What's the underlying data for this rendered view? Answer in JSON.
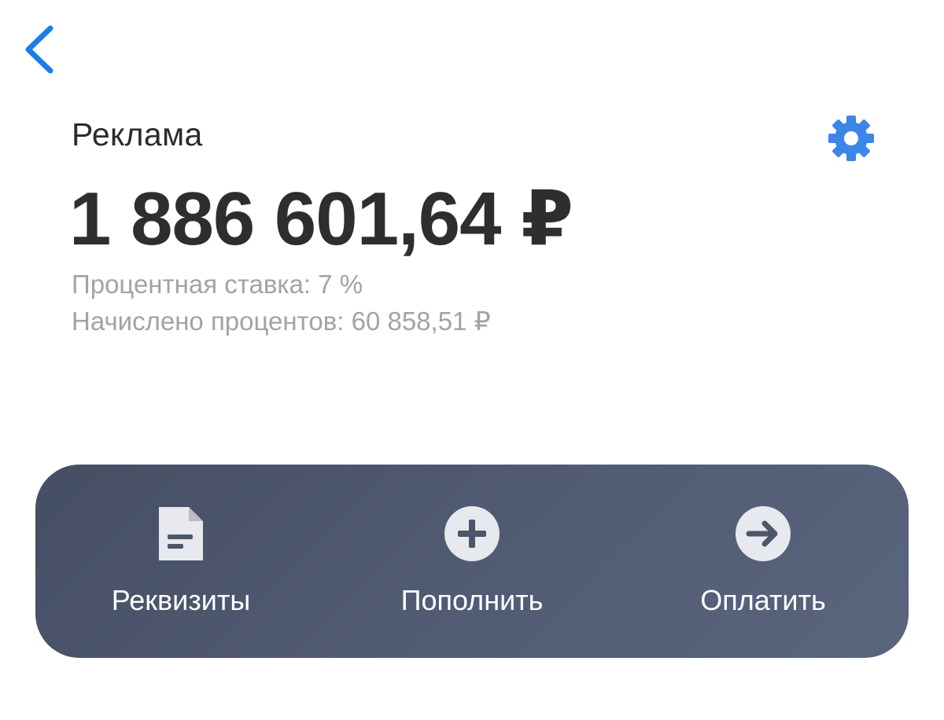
{
  "header": {
    "back_icon": "chevron-left-icon",
    "settings_icon": "gear-icon",
    "accent_color": "#1a7ee8"
  },
  "account": {
    "name": "Реклама",
    "balance": "1 886 601,64 ₽",
    "interest_rate": "Процентная ставка: 7 %",
    "accrued_interest": "Начислено процентов: 60 858,51 ₽"
  },
  "actions": [
    {
      "label": "Реквизиты",
      "icon": "document-icon"
    },
    {
      "label": "Пополнить",
      "icon": "plus-circle-icon"
    },
    {
      "label": "Оплатить",
      "icon": "arrow-right-circle-icon"
    }
  ],
  "colors": {
    "panel_start": "#454e63",
    "panel_end": "#5a657e",
    "primary_text": "#2e2e30",
    "secondary_text": "#a2a3a8"
  }
}
